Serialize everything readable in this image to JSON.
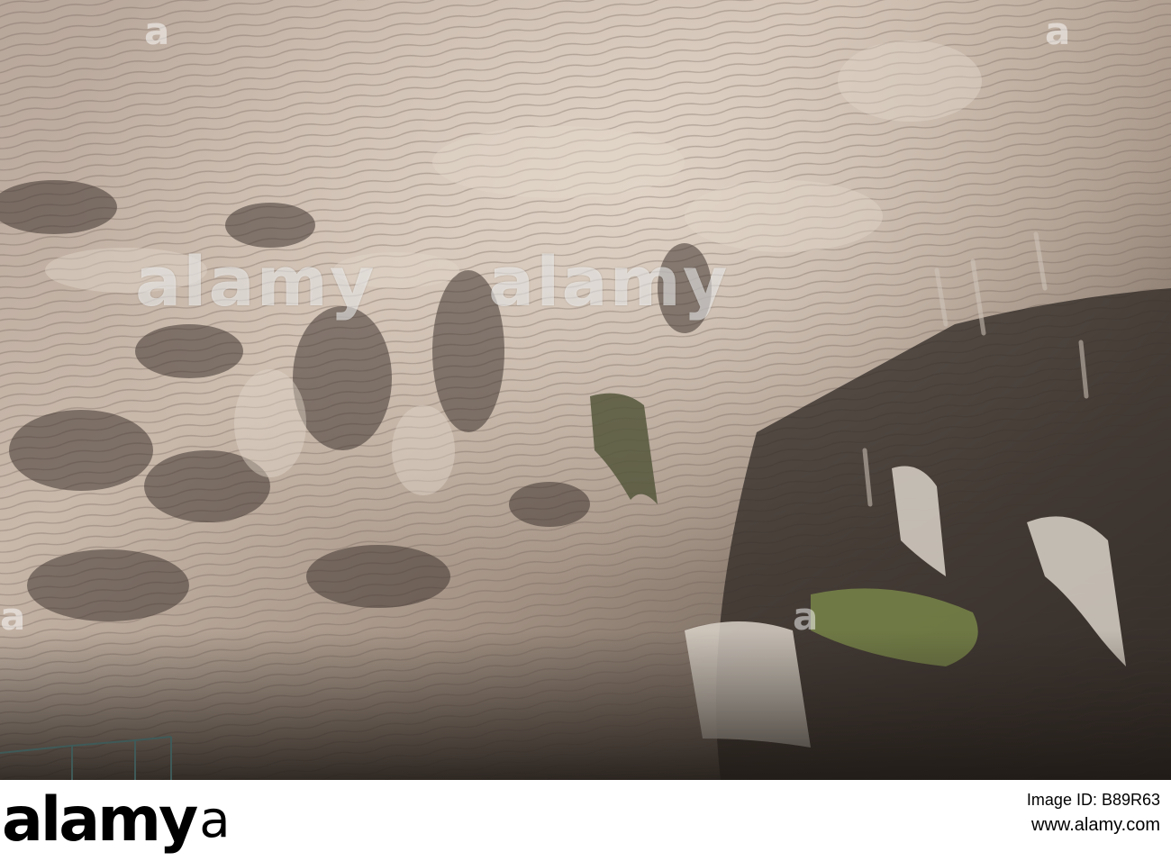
{
  "photo": {
    "subject": "cave ceiling",
    "watermark": [
      "alamy",
      "a",
      "alamy",
      "a"
    ]
  },
  "banner": {
    "logo": "alamy",
    "image_id_label": "Image ID: B89R63",
    "image_id": "B89R63",
    "site": "www.alamy.com"
  },
  "colors": {
    "rock_light": "#d8cbc0",
    "rock_mid": "#a89889",
    "rock_dark": "#4a3f38",
    "moss": "#7a8a4a"
  }
}
